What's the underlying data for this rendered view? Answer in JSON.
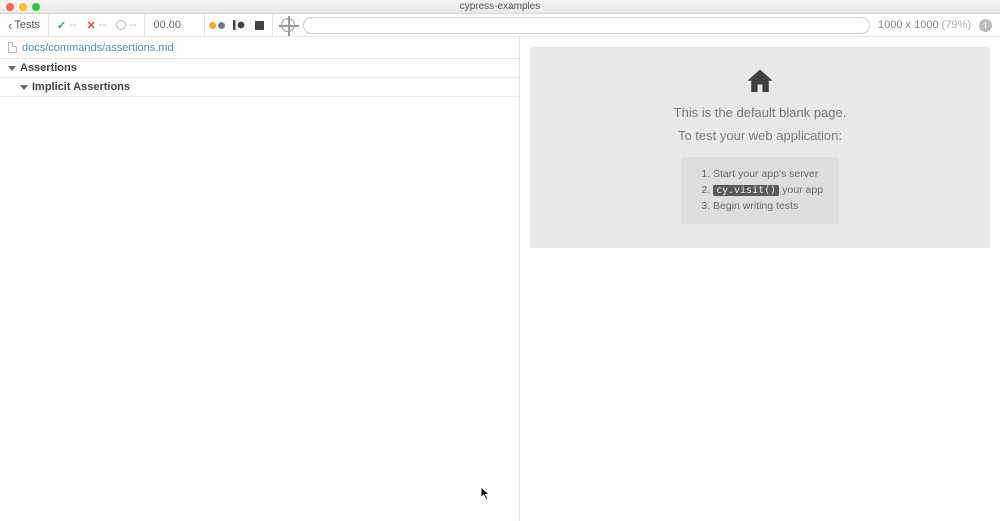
{
  "window": {
    "title": "cypress-examples"
  },
  "toolbar": {
    "back_label": "Tests",
    "pass_count": "--",
    "fail_count": "--",
    "pending_count": "--",
    "timer": "00.00"
  },
  "viewport": {
    "dimensions": "1000 x 1000",
    "scale": "(79%)"
  },
  "spec": {
    "file_path": "docs/commands/assertions.md",
    "tree": [
      {
        "label": "Assertions",
        "level": 0
      },
      {
        "label": "Implicit Assertions",
        "level": 1
      }
    ]
  },
  "preview": {
    "blank_title": "This is the default blank page.",
    "blank_sub": "To test your web application:",
    "steps": {
      "s1": "Start your app's server",
      "s2_code": "cy.visit()",
      "s2_rest": " your app",
      "s3": "Begin writing tests"
    }
  }
}
